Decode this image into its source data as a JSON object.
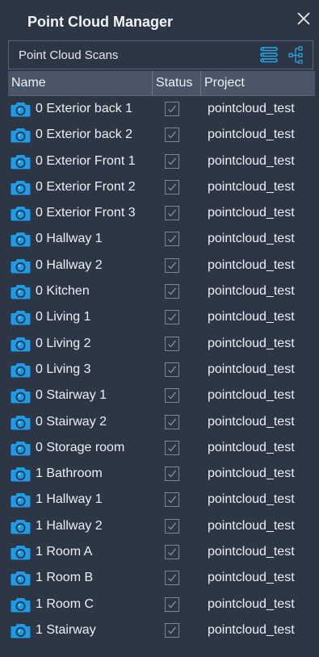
{
  "window": {
    "title": "Point Cloud Manager"
  },
  "selector": {
    "label": "Point Cloud Scans"
  },
  "table": {
    "columns": {
      "name": "Name",
      "status": "Status",
      "project": "Project"
    },
    "rows": [
      {
        "name": "0 Exterior back 1",
        "status": true,
        "project": "pointcloud_test"
      },
      {
        "name": "0 Exterior back 2",
        "status": true,
        "project": "pointcloud_test"
      },
      {
        "name": "0 Exterior Front 1",
        "status": true,
        "project": "pointcloud_test"
      },
      {
        "name": "0 Exterior Front 2",
        "status": true,
        "project": "pointcloud_test"
      },
      {
        "name": "0 Exterior Front 3",
        "status": true,
        "project": "pointcloud_test"
      },
      {
        "name": "0 Hallway 1",
        "status": true,
        "project": "pointcloud_test"
      },
      {
        "name": "0 Hallway 2",
        "status": true,
        "project": "pointcloud_test"
      },
      {
        "name": "0 Kitchen",
        "status": true,
        "project": "pointcloud_test"
      },
      {
        "name": "0 Living 1",
        "status": true,
        "project": "pointcloud_test"
      },
      {
        "name": "0 Living 2",
        "status": true,
        "project": "pointcloud_test"
      },
      {
        "name": "0 Living 3",
        "status": true,
        "project": "pointcloud_test"
      },
      {
        "name": "0 Stairway 1",
        "status": true,
        "project": "pointcloud_test"
      },
      {
        "name": "0 Stairway 2",
        "status": true,
        "project": "pointcloud_test"
      },
      {
        "name": "0 Storage room",
        "status": true,
        "project": "pointcloud_test"
      },
      {
        "name": "1 Bathroom",
        "status": true,
        "project": "pointcloud_test"
      },
      {
        "name": "1 Hallway 1",
        "status": true,
        "project": "pointcloud_test"
      },
      {
        "name": "1 Hallway 2",
        "status": true,
        "project": "pointcloud_test"
      },
      {
        "name": "1 Room A",
        "status": true,
        "project": "pointcloud_test"
      },
      {
        "name": "1 Room B",
        "status": true,
        "project": "pointcloud_test"
      },
      {
        "name": "1 Room C",
        "status": true,
        "project": "pointcloud_test"
      },
      {
        "name": "1 Stairway",
        "status": true,
        "project": "pointcloud_test"
      }
    ]
  },
  "icons": {
    "close": "close-icon",
    "list_view": "list-view-icon",
    "tree_view": "tree-view-icon",
    "row_icon": "camera-icon",
    "status": "checkbox-checked-icon"
  },
  "colors": {
    "background": "#2c3645",
    "header": "#4a5568",
    "accent_icon": "#1e9be6",
    "text": "#eef0f3"
  }
}
